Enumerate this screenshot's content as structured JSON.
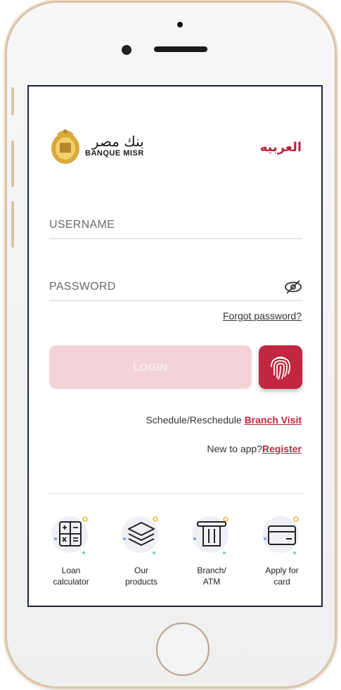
{
  "header": {
    "logo_arabic": "بنك مصر",
    "logo_english": "BANQUE MISR",
    "language_link": "العربيه"
  },
  "login_form": {
    "username_placeholder": "USERNAME",
    "password_placeholder": "PASSWORD",
    "forgot_password": "Forgot password?",
    "login_label": "LOGIN"
  },
  "branch_visit": {
    "prefix": "Schedule/Reschedule ",
    "link": "Branch Visit"
  },
  "register": {
    "prefix": "New to app?",
    "link": "Register"
  },
  "quick_links": [
    {
      "label_line1": "Loan",
      "label_line2": "calculator",
      "icon": "calculator-icon"
    },
    {
      "label_line1": "Our",
      "label_line2": "products",
      "icon": "layers-icon"
    },
    {
      "label_line1": "Branch/",
      "label_line2": "ATM",
      "icon": "atm-icon"
    },
    {
      "label_line1": "Apply for",
      "label_line2": "card",
      "icon": "credit-card-icon"
    }
  ],
  "colors": {
    "brand_red": "#c1273f",
    "login_disabled": "#f3d3d8",
    "logo_gold": "#d8a93a"
  }
}
